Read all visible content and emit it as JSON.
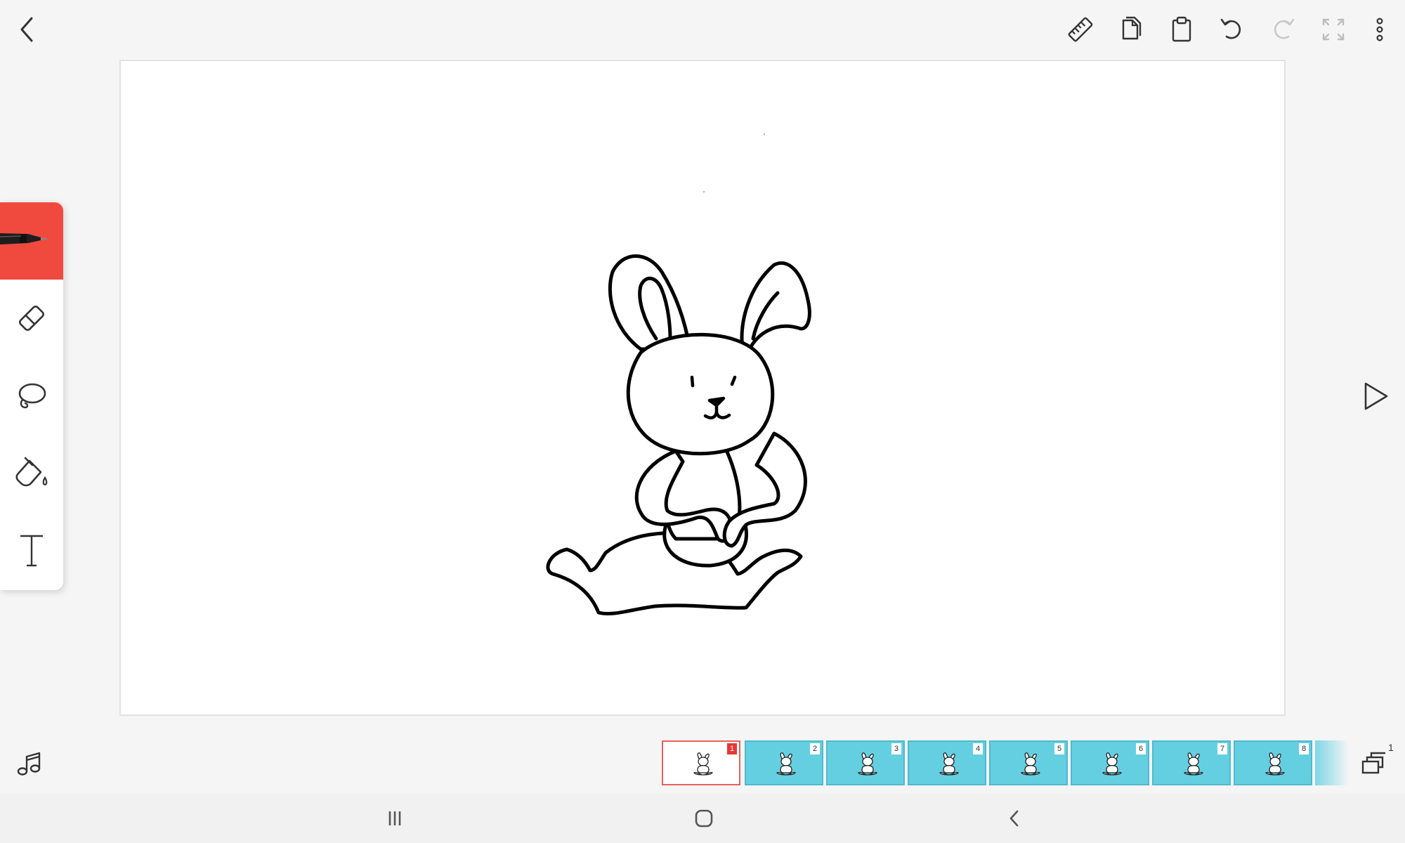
{
  "top_bar": {
    "icons": [
      "back-icon",
      "ruler-icon",
      "copy-icon",
      "paste-icon",
      "undo-icon",
      "redo-icon",
      "fullscreen-icon",
      "more-vertical-icon"
    ]
  },
  "tools": {
    "active": "pen",
    "items": [
      "pen",
      "eraser",
      "lasso",
      "fill",
      "text"
    ]
  },
  "player": {
    "icon": "play-icon"
  },
  "audio": {
    "icon": "music-note-icon"
  },
  "timeline": {
    "selected_frame": 1,
    "frames": [
      {
        "number": "1"
      },
      {
        "number": "2"
      },
      {
        "number": "3"
      },
      {
        "number": "4"
      },
      {
        "number": "5"
      },
      {
        "number": "6"
      },
      {
        "number": "7"
      },
      {
        "number": "8"
      }
    ],
    "layers_count": "1"
  },
  "system_nav": {
    "icons": [
      "recents-icon",
      "home-icon",
      "nav-back-icon"
    ]
  },
  "colors": {
    "accent_active_tool": "#f04a3e",
    "frame_fill": "#64cfe1",
    "selected_frame_badge": "#e53935",
    "canvas": "#ffffff",
    "background": "#f5f5f5"
  }
}
